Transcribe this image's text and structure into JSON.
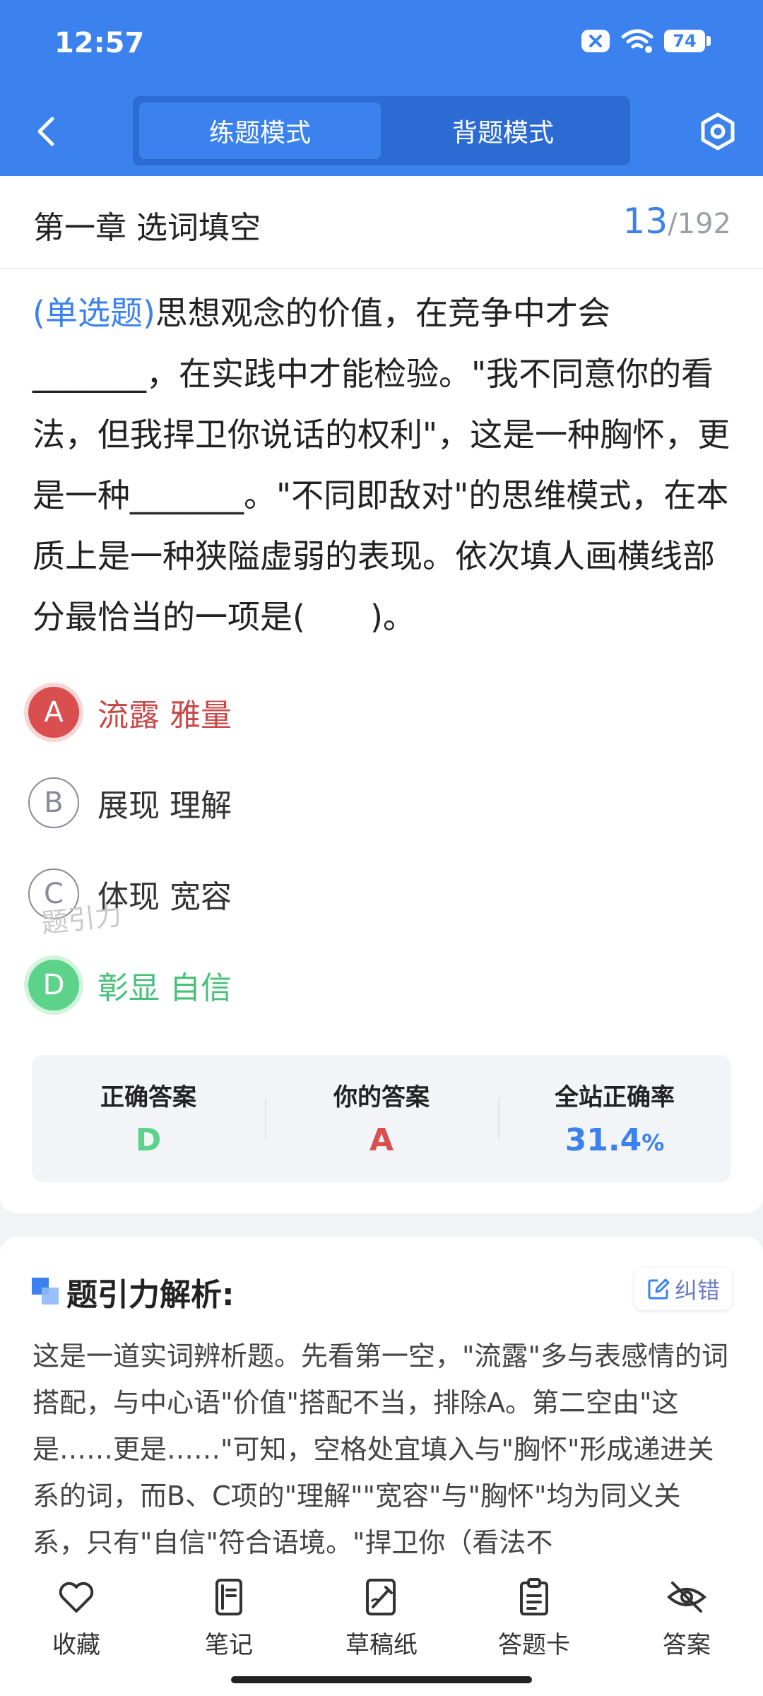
{
  "status_bar": {
    "time": "12:57",
    "battery": "74"
  },
  "header": {
    "mode_practice": "练题模式",
    "mode_recite": "背题模式"
  },
  "chapter": {
    "title": "第一章 选词填空",
    "current": "13",
    "total": "/192"
  },
  "question": {
    "type": "(单选题)",
    "text": "思想观念的价值，在竞争中才会_______，在实践中才能检验。\"我不同意你的看法，但我捍卫你说话的权利\"，这是一种胸怀，更是一种_______。\"不同即敌对\"的思维模式，在本质上是一种狭隘虚弱的表现。依次填人画横线部分最恰当的一项是(　　)。"
  },
  "options": [
    {
      "letter": "A",
      "text": "流露 雅量",
      "state": "wrong"
    },
    {
      "letter": "B",
      "text": "展现 理解",
      "state": "normal"
    },
    {
      "letter": "C",
      "text": "体现 宽容",
      "state": "normal"
    },
    {
      "letter": "D",
      "text": "彰显 自信",
      "state": "right"
    }
  ],
  "watermark": "题引力",
  "stats": {
    "correct_label": "正确答案",
    "correct_value": "D",
    "yours_label": "你的答案",
    "yours_value": "A",
    "rate_label": "全站正确率",
    "rate_value": "31.4",
    "rate_unit": "%"
  },
  "analysis": {
    "title": "题引力解析:",
    "report_label": "纠错",
    "text": "这是一道实词辨析题。先看第一空，\"流露\"多与表感情的词搭配，与中心语\"价值\"搭配不当，排除A。第二空由\"这是……更是……\"可知，空格处宜填入与\"胸怀\"形成递进关系的词，而B、C项的\"理解\"\"宽容\"与\"胸怀\"均为同义关系，只有\"自信\"符合语境。\"捍卫你（看法不"
  },
  "bottom_nav": [
    {
      "label": "收藏",
      "icon": "heart-icon"
    },
    {
      "label": "笔记",
      "icon": "notebook-icon"
    },
    {
      "label": "草稿纸",
      "icon": "draft-pen-icon"
    },
    {
      "label": "答题卡",
      "icon": "clipboard-icon"
    },
    {
      "label": "答案",
      "icon": "eye-off-icon"
    }
  ],
  "colors": {
    "primary": "#3b82ee",
    "wrong": "#d94f4f",
    "right": "#5dd28a"
  }
}
